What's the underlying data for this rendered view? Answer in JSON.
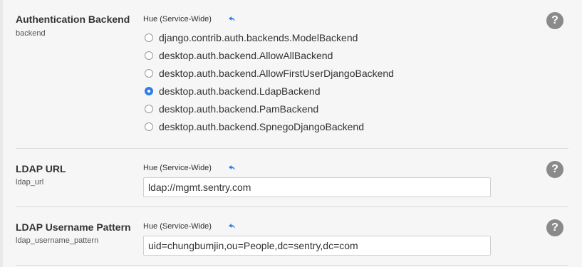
{
  "backend": {
    "title": "Authentication Backend",
    "key": "backend",
    "scope": "Hue (Service-Wide)",
    "options": [
      {
        "label": "django.contrib.auth.backends.ModelBackend",
        "checked": false
      },
      {
        "label": "desktop.auth.backend.AllowAllBackend",
        "checked": false
      },
      {
        "label": "desktop.auth.backend.AllowFirstUserDjangoBackend",
        "checked": false
      },
      {
        "label": "desktop.auth.backend.LdapBackend",
        "checked": true
      },
      {
        "label": "desktop.auth.backend.PamBackend",
        "checked": false
      },
      {
        "label": "desktop.auth.backend.SpnegoDjangoBackend",
        "checked": false
      }
    ]
  },
  "ldap_url": {
    "title": "LDAP URL",
    "key": "ldap_url",
    "scope": "Hue (Service-Wide)",
    "value": "ldap://mgmt.sentry.com"
  },
  "ldap_username_pattern": {
    "title": "LDAP Username Pattern",
    "key": "ldap_username_pattern",
    "scope": "Hue (Service-Wide)",
    "value": "uid=chungbumjin,ou=People,dc=sentry,dc=com"
  },
  "help_glyph": "?",
  "colors": {
    "accent": "#2f7ee6",
    "help": "#8a8a8a"
  }
}
